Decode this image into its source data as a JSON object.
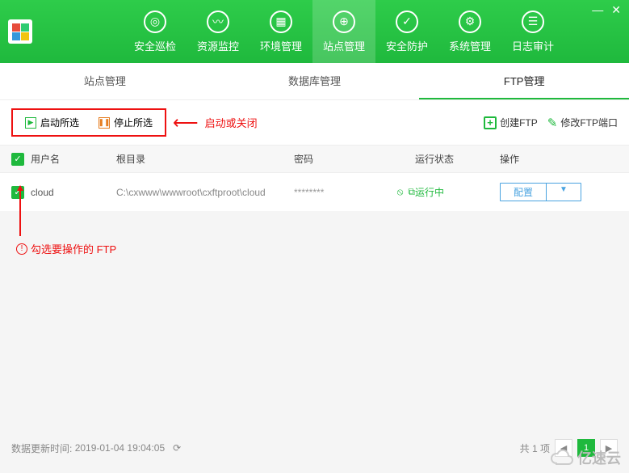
{
  "nav": {
    "items": [
      {
        "label": "安全巡检"
      },
      {
        "label": "资源监控"
      },
      {
        "label": "环境管理"
      },
      {
        "label": "站点管理"
      },
      {
        "label": "安全防护"
      },
      {
        "label": "系统管理"
      },
      {
        "label": "日志审计"
      }
    ]
  },
  "subtabs": {
    "items": [
      {
        "label": "站点管理"
      },
      {
        "label": "数据库管理"
      },
      {
        "label": "FTP管理"
      }
    ]
  },
  "toolbar": {
    "start_all": "启动所选",
    "stop_all": "停止所选",
    "anno_startstop": "启动或关闭",
    "create_ftp": "创建FTP",
    "modify_port": "修改FTP端口"
  },
  "table": {
    "headers": {
      "user": "用户名",
      "root": "根目录",
      "pwd": "密码",
      "status": "运行状态",
      "ops": "操作"
    },
    "rows": [
      {
        "user": "cloud",
        "root": "C:\\cxwww\\wwwroot\\cxftproot\\cloud",
        "pwd": "********",
        "status": "运行中",
        "config": "配置"
      }
    ]
  },
  "annotations": {
    "check_hint": "勾选要操作的 FTP"
  },
  "footer": {
    "update_label": "数据更新时间:",
    "update_time": "2019-01-04 19:04:05",
    "total_label": "共 1 项",
    "page_current": "1"
  },
  "watermark": "亿速云"
}
